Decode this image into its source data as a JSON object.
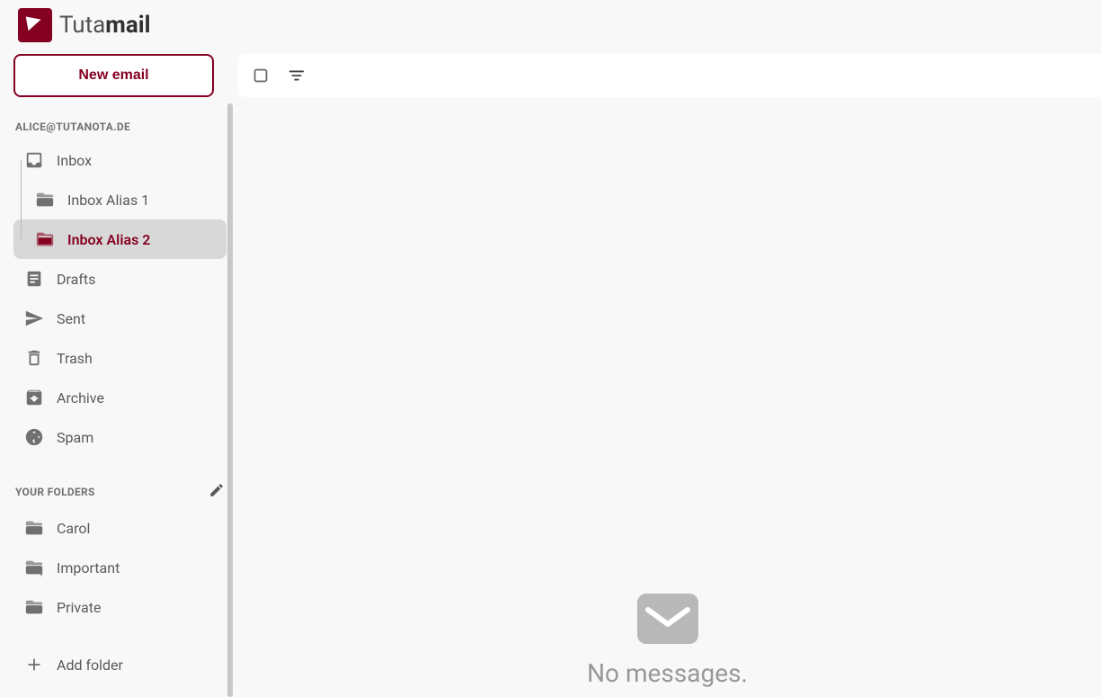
{
  "brand": {
    "name_start": "Tuta",
    "name_end": "mail"
  },
  "compose_button": "New email",
  "account_email": "ALICE@TUTANOTA.DE",
  "system_folders": [
    {
      "id": "inbox",
      "label": "Inbox",
      "icon": "inbox",
      "indented": false,
      "selected": false
    },
    {
      "id": "inbox-alias-1",
      "label": "Inbox Alias 1",
      "icon": "folder",
      "indented": true,
      "selected": false
    },
    {
      "id": "inbox-alias-2",
      "label": "Inbox Alias 2",
      "icon": "folder-open",
      "indented": true,
      "selected": true
    },
    {
      "id": "drafts",
      "label": "Drafts",
      "icon": "drafts",
      "indented": false,
      "selected": false
    },
    {
      "id": "sent",
      "label": "Sent",
      "icon": "sent",
      "indented": false,
      "selected": false
    },
    {
      "id": "trash",
      "label": "Trash",
      "icon": "trash",
      "indented": false,
      "selected": false
    },
    {
      "id": "archive",
      "label": "Archive",
      "icon": "archive",
      "indented": false,
      "selected": false
    },
    {
      "id": "spam",
      "label": "Spam",
      "icon": "spam",
      "indented": false,
      "selected": false
    }
  ],
  "your_folders_header": "YOUR FOLDERS",
  "user_folders": [
    {
      "id": "carol",
      "label": "Carol",
      "icon": "folder"
    },
    {
      "id": "important",
      "label": "Important",
      "icon": "folder-plus"
    },
    {
      "id": "private",
      "label": "Private",
      "icon": "folder"
    }
  ],
  "add_folder_label": "Add folder",
  "empty_state_text": "No messages.",
  "colors": {
    "accent": "#850122"
  }
}
